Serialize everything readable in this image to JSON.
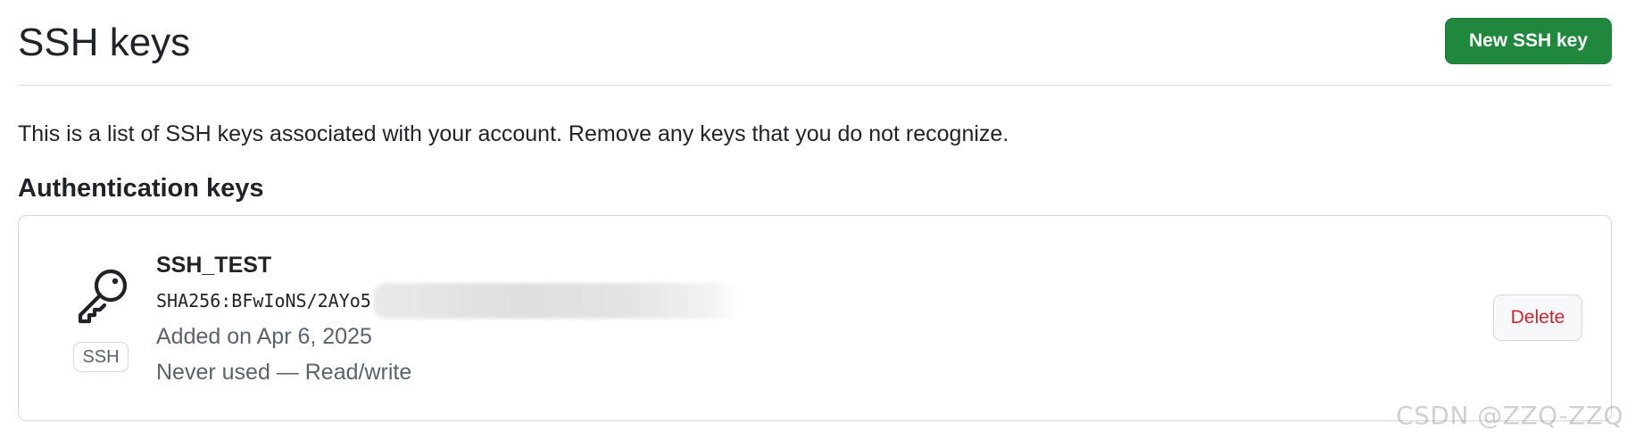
{
  "header": {
    "title": "SSH keys",
    "new_key_label": "New SSH key"
  },
  "description": "This is a list of SSH keys associated with your account. Remove any keys that you do not recognize.",
  "authentication": {
    "heading": "Authentication keys",
    "keys": [
      {
        "title": "SSH_TEST",
        "badge": "SSH",
        "icon": "key-icon",
        "fingerprint": "SHA256:BFwIoNS/2AYo5",
        "added": "Added on Apr 6, 2025",
        "usage": "Never used — Read/write",
        "delete_label": "Delete"
      }
    ]
  },
  "watermark": "CSDN @ZZQ-ZZQ",
  "colors": {
    "primary_button": "#1f883d",
    "danger_text": "#d1242f",
    "muted_text": "#59636e",
    "border": "#d0d7de"
  }
}
